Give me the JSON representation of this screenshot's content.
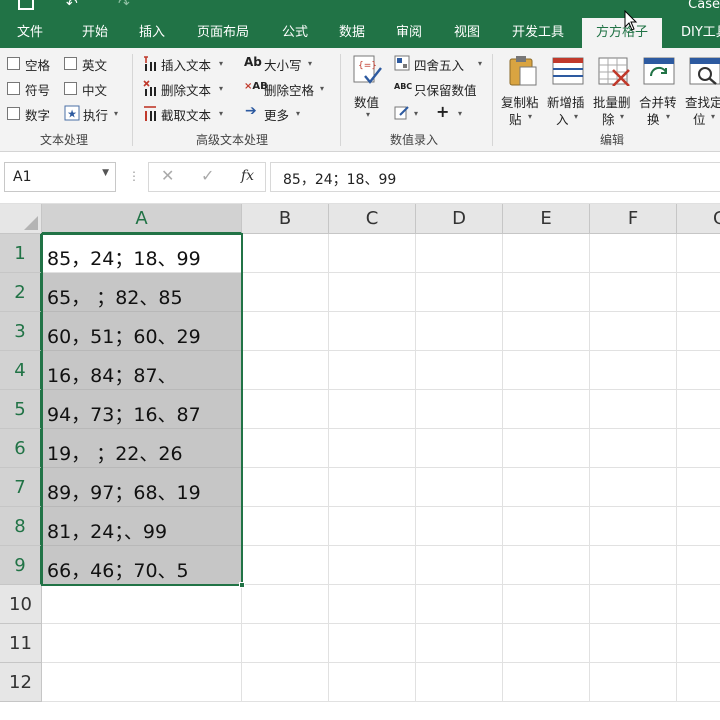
{
  "window": {
    "title": "Case"
  },
  "tabs": [
    {
      "label": "文件",
      "active": false
    },
    {
      "label": "开始",
      "active": false
    },
    {
      "label": "插入",
      "active": false
    },
    {
      "label": "页面布局",
      "active": false
    },
    {
      "label": "公式",
      "active": false
    },
    {
      "label": "数据",
      "active": false
    },
    {
      "label": "审阅",
      "active": false
    },
    {
      "label": "视图",
      "active": false
    },
    {
      "label": "开发工具",
      "active": false
    },
    {
      "label": "方方格子",
      "active": true
    },
    {
      "label": "DIY工具",
      "active": false
    }
  ],
  "ribbon": {
    "text_processing": {
      "group_label": "文本处理",
      "checkboxes": [
        {
          "label": "空格",
          "checked": false
        },
        {
          "label": "英文",
          "checked": false
        },
        {
          "label": "符号",
          "checked": false
        },
        {
          "label": "中文",
          "checked": false
        },
        {
          "label": "数字",
          "checked": false
        }
      ],
      "execute_label": "执行"
    },
    "advanced_text": {
      "group_label": "高级文本处理",
      "insert_text": "插入文本",
      "delete_text": "删除文本",
      "extract_text": "截取文本",
      "case_label": "大小写",
      "remove_spaces": "删除空格",
      "more_label": "更多"
    },
    "numeric": {
      "group_label": "数值录入",
      "value_label": "数值",
      "round_label": "四舍五入",
      "keep_values": "只保留数值"
    },
    "edit": {
      "group_label": "编辑",
      "copy_paste": [
        "复制粘",
        "贴"
      ],
      "new_insert": [
        "新增插",
        "入"
      ],
      "batch_delete": [
        "批量删",
        "除"
      ],
      "merge_convert": [
        "合并转",
        "换"
      ],
      "find_locate": [
        "查找定",
        "位"
      ]
    }
  },
  "formula_bar": {
    "name_box": "A1",
    "fx_label": "fx",
    "content": "85，24；18、99"
  },
  "sheet": {
    "corner": "",
    "columns": [
      "A",
      "B",
      "C",
      "D",
      "E",
      "F",
      "G"
    ],
    "rows": [
      "1",
      "2",
      "3",
      "4",
      "5",
      "6",
      "7",
      "8",
      "9",
      "10",
      "11",
      "12"
    ],
    "active_cell": "A1",
    "selection": "A1:A9",
    "col_a_values": [
      "85，24；18、99",
      "65，  ；82、85",
      "60，51；60、29",
      "16，84；87、",
      "94，73；16、87",
      "19，  ；22、26",
      "89，97；68、19",
      "81，24；、99",
      "66，46；70、5"
    ]
  },
  "colors": {
    "accent": "#217346",
    "selection_fill": "#c6c6c6"
  }
}
